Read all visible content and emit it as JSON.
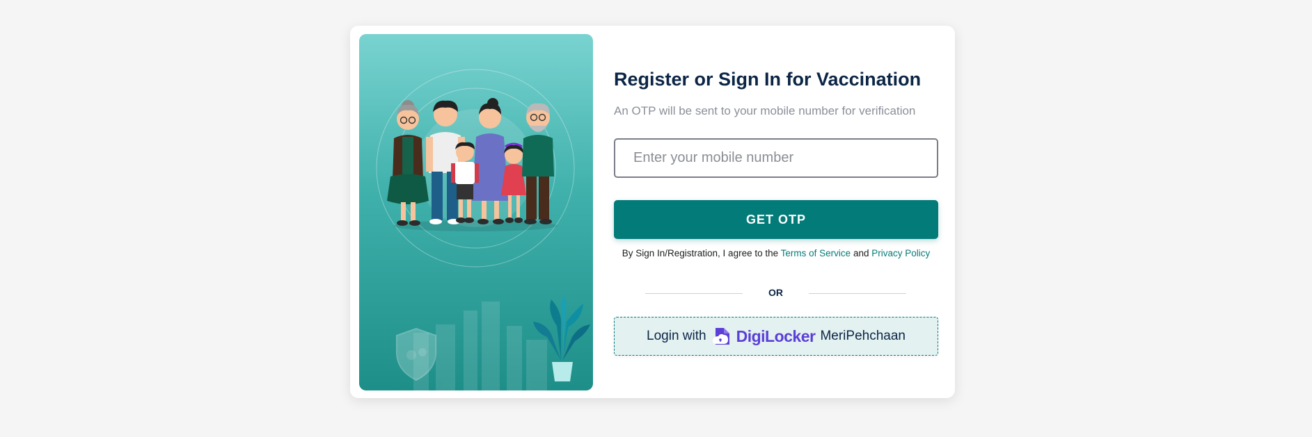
{
  "login": {
    "title": "Register or Sign In for Vaccination",
    "subtitle": "An OTP will be sent to your mobile number for verification",
    "mobile_placeholder": "Enter your mobile number",
    "otp_button": "GET OTP",
    "terms_prefix": "By Sign In/Registration, I agree to the",
    "terms_link": "Terms of Service",
    "terms_and": "and",
    "privacy_link": "Privacy Policy",
    "or_text": "OR",
    "digilocker_prefix": "Login with",
    "digilocker_name": "DigiLocker",
    "digilocker_suffix": "MeriPehchaan"
  },
  "colors": {
    "accent": "#037b79",
    "heading": "#0b2545",
    "digilocker": "#5b3fd6",
    "digilocker_bg": "#e3f1f1"
  },
  "icons": [
    "family-illustration",
    "shield-icon",
    "plant-icon",
    "digilocker-logo-icon"
  ]
}
